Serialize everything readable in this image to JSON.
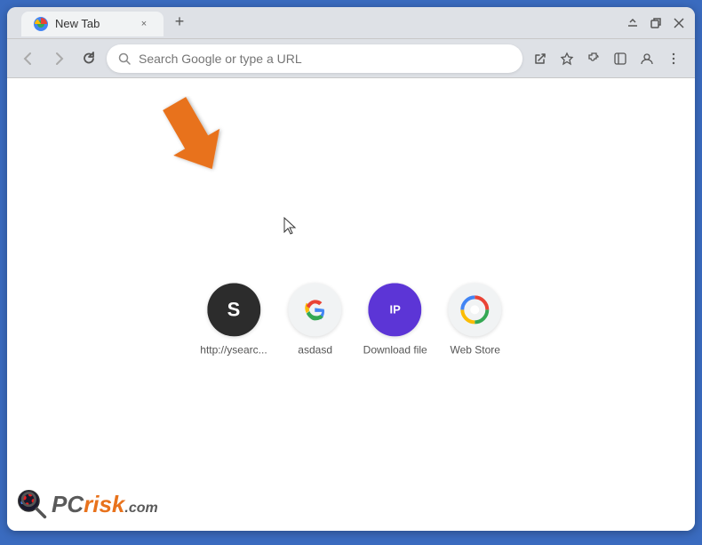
{
  "browser": {
    "tab": {
      "title": "New Tab",
      "favicon": "●",
      "close_label": "×"
    },
    "new_tab_label": "+",
    "window_controls": {
      "minimize": "—",
      "maximize": "□",
      "close": "✕",
      "menu": "⋮",
      "arrows": "⌄"
    },
    "address_bar": {
      "placeholder": "Search Google or type a URL",
      "value": ""
    },
    "toolbar_icons": {
      "back": "←",
      "forward": "→",
      "refresh": "↻",
      "search": "⌕",
      "share": "⎙",
      "bookmark": "☆",
      "extension": "⬡",
      "sidebar": "⧉",
      "profile": "○",
      "menu": "⋮"
    }
  },
  "shortcuts": [
    {
      "id": "ysearch",
      "label": "http://ysearc...",
      "icon_type": "ysearch",
      "icon_text": "S"
    },
    {
      "id": "asdasd",
      "label": "asdasd",
      "icon_type": "google",
      "icon_text": "G"
    },
    {
      "id": "download-file",
      "label": "Download file",
      "icon_type": "ip",
      "icon_text": "IP"
    },
    {
      "id": "web-store",
      "label": "Web Store",
      "icon_type": "webstore",
      "icon_text": "🌈"
    }
  ],
  "annotation": {
    "arrow_color": "#e8721c"
  },
  "watermark": {
    "pc_text": "PC",
    "risk_text": "risk",
    "com_text": ".com"
  }
}
